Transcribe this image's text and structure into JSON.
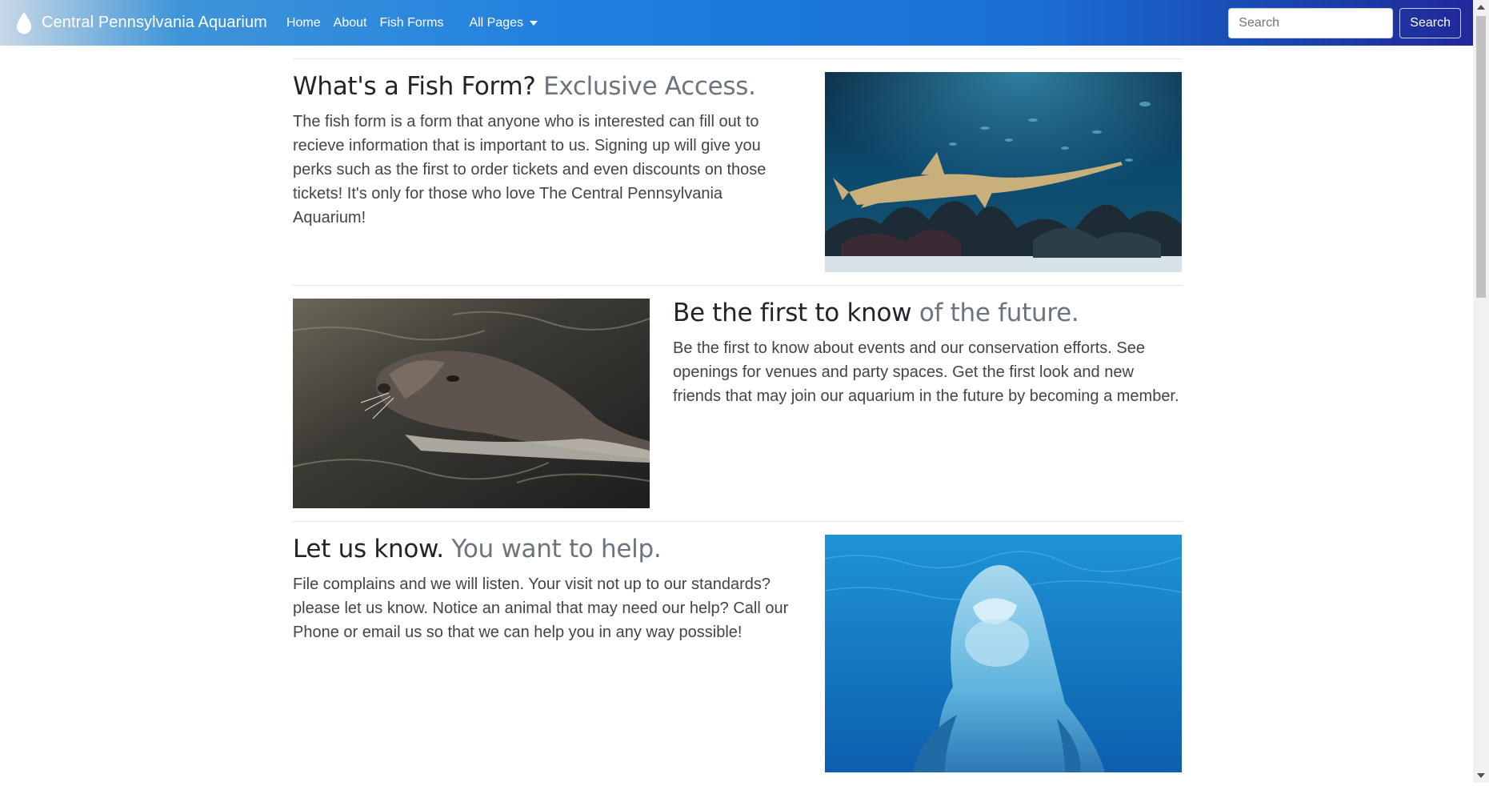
{
  "navbar": {
    "brand": "Central Pennsylvania Aquarium",
    "brand_icon": "water-drop-icon",
    "links": [
      "Home",
      "About",
      "Fish Forms"
    ],
    "dropdown_label": "All Pages",
    "search_placeholder": "Search",
    "search_button": "Search"
  },
  "features": [
    {
      "heading": "What's a Fish Form?",
      "heading_muted": "Exclusive Access.",
      "text": "The fish form is a form that anyone who is interested can fill out to recieve information that is important to us. Signing up will give you perks such as the first to order tickets and even discounts on those tickets! It's only for those who love The Central Pennsylvania Aquarium!",
      "image": "sawfish-aquarium-photo"
    },
    {
      "heading": "Be the first to know",
      "heading_muted": "of the future.",
      "text": "Be the first to know about events and our conservation efforts. See openings for venues and party spaces. Get the first look and new friends that may join our aquarium in the future by becoming a member.",
      "image": "sea-lion-photo"
    },
    {
      "heading": "Let us know.",
      "heading_muted": "You want to help.",
      "text": "File complains and we will listen. Your visit not up to our standards? please let us know. Notice an animal that may need our help? Call our Phone or email us so that we can help you in any way possible!",
      "image": "dolphin-photo"
    }
  ],
  "colors": {
    "nav_gradient_start": "#3f95d8",
    "nav_gradient_end": "#22289a",
    "muted_text": "#6c757d",
    "heading_text": "#212529"
  }
}
